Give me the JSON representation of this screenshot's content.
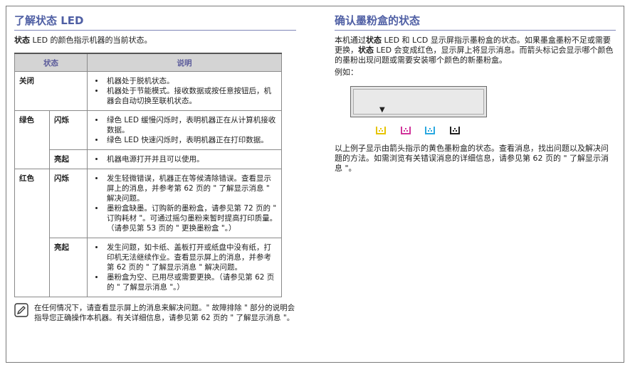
{
  "left": {
    "title": "了解状态 LED",
    "intro_bold": "状态",
    "intro_rest": " LED 的颜色指示机器的当前状态。",
    "table": {
      "headers": [
        "状态",
        "说明"
      ],
      "off_label": "关闭",
      "off_items": [
        "机器处于脱机状态。",
        "机器处于节能模式。接收数据或按任意按钮后，机器会自动切换至联机状态。"
      ],
      "green_label": "绿色",
      "green_blink_label": "闪烁",
      "green_blink_items": [
        "绿色 LED 缓慢闪烁时，表明机器正在从计算机接收数据。",
        "绿色 LED 快速闪烁时，表明机器正在打印数据。"
      ],
      "green_on_label": "亮起",
      "green_on_items": [
        "机器电源打开并且可以使用。"
      ],
      "red_label": "红色",
      "red_blink_label": "闪烁",
      "red_blink_items": [
        "发生轻微错误，机器正在等候清除错误。查看显示屏上的消息，并参考第 62 页的 \" 了解显示消息 \" 解决问题。",
        "墨粉盒缺墨。订购新的墨粉盒，请参见第 72 页的 \" 订购耗材 \"。可通过摇匀墨粉来暂时提高打印质量。（请参见第 53 页的 \" 更换墨粉盒 \"。）"
      ],
      "red_on_label": "亮起",
      "red_on_items": [
        "发生问题，如卡纸、盖板打开或纸盘中没有纸，打印机无法继续作业。查看显示屏上的消息，并参考第 62 页的 \" 了解显示消息 \" 解决问题。",
        "墨粉盒为空、已用尽或需要更换。（请参见第 62 页的 \" 了解显示消息 \"。）"
      ]
    },
    "note": "在任何情况下，请查看显示屏上的消息来解决问题。\" 故障排除 \" 部分的说明会指导您正确操作本机器。有关详细信息，请参见第 62 页的 \" 了解显示消息 \"。",
    "note_icon": "note-pencil-icon"
  },
  "right": {
    "title": "确认墨粉盒的状态",
    "p1_a": "本机通过",
    "p1_b1": "状态",
    "p1_c": " LED 和 LCD 显示屏指示墨粉盒的状态。如果墨盒墨粉不足或需要更换，",
    "p1_b2": "状态",
    "p1_d": " LED 会变成红色，显示屏上将显示消息。而箭头标记会显示哪个颜色的墨粉出现问题或需要安装哪个颜色的新墨粉盒。",
    "example_label": "例如：",
    "lcd_arrow": "▼",
    "toner_colors": [
      "#e6c400",
      "#d0339a",
      "#2aa8e0",
      "#222222"
    ],
    "p2": "以上例子显示由箭头指示的黄色墨粉盒的状态。查看消息，找出问题以及解决问题的方法。如需浏览有关错误消息的详细信息，请参见第 62 页的 \" 了解显示消息 \"。"
  }
}
